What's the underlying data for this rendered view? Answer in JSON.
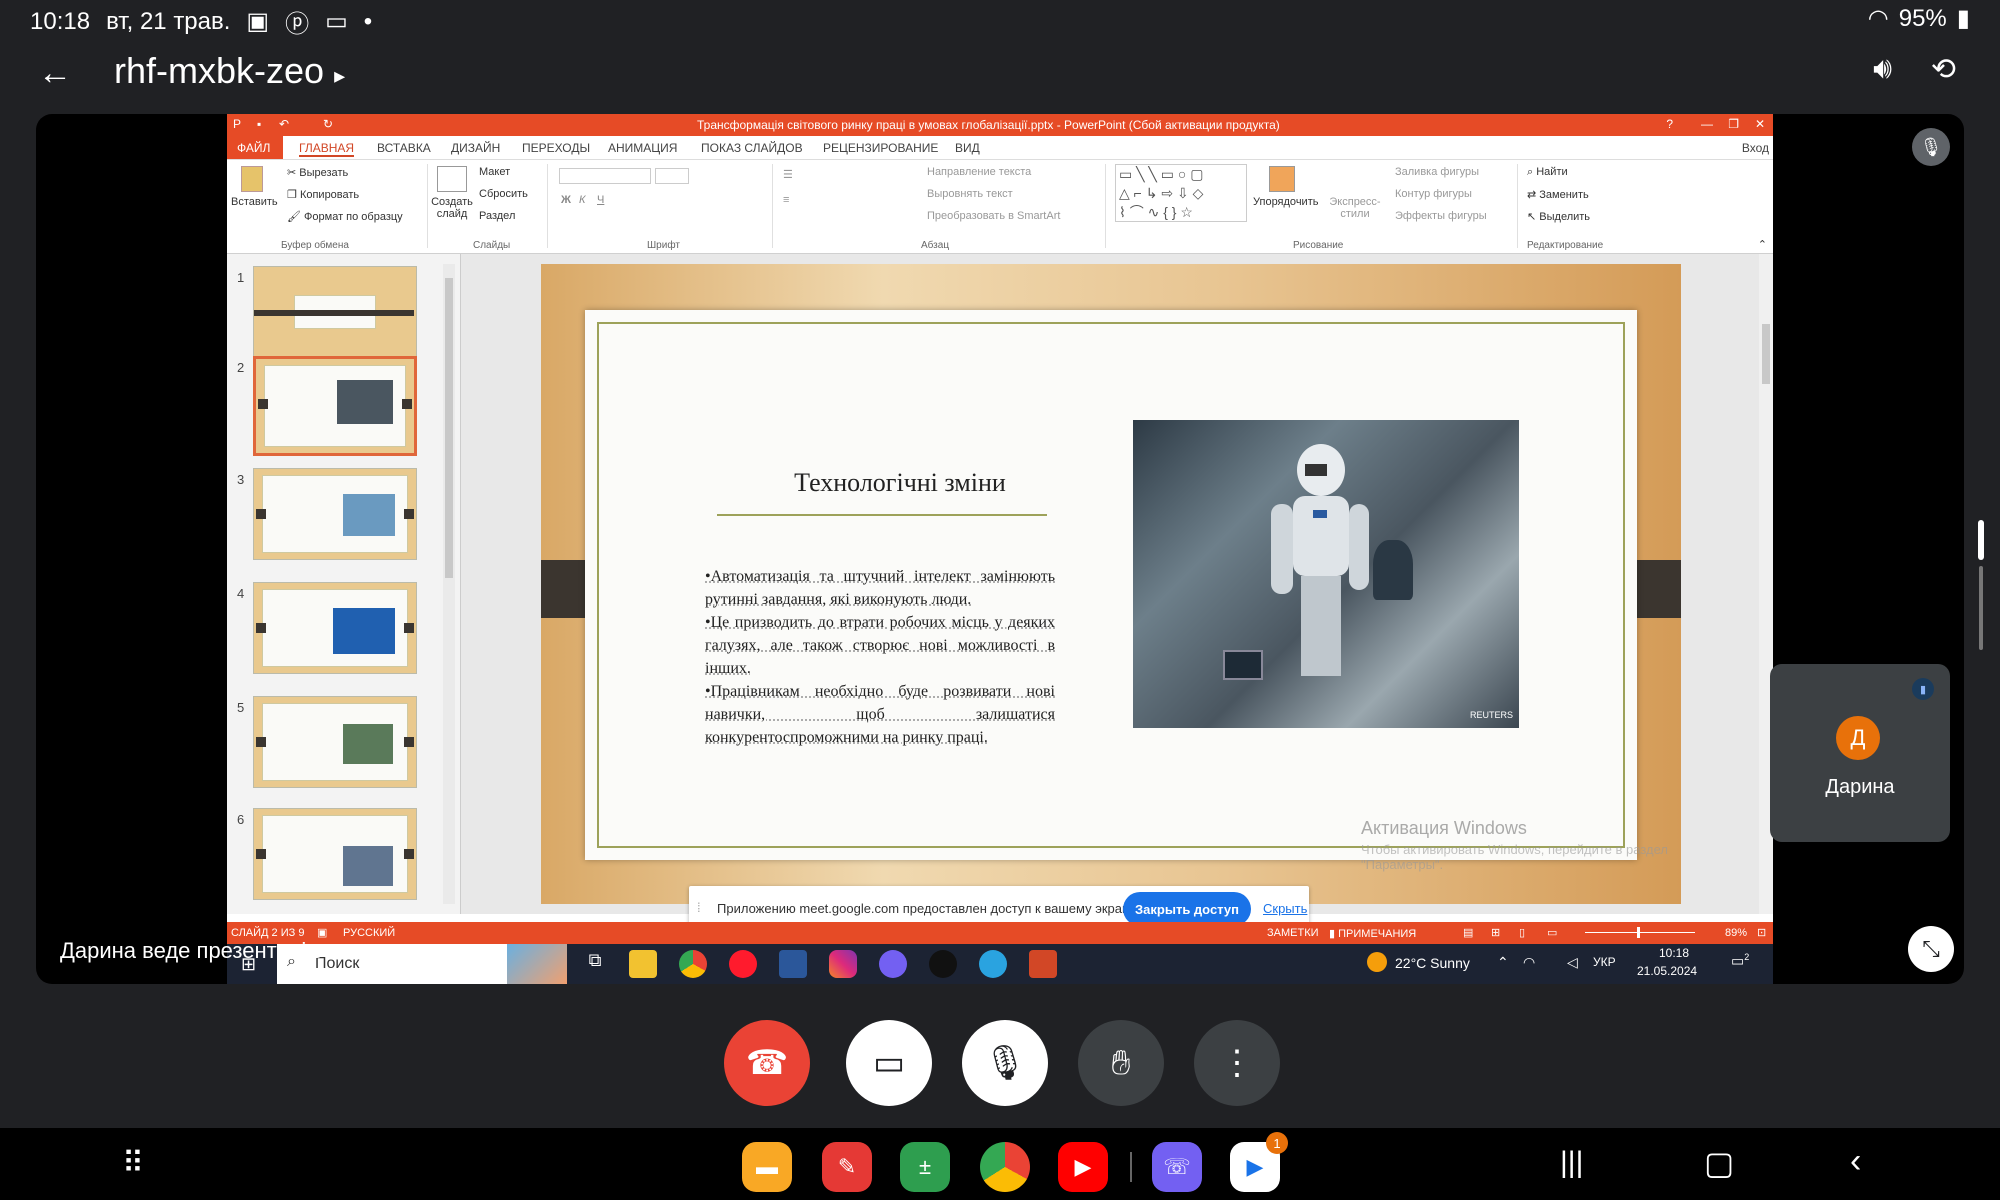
{
  "status_bar": {
    "time": "10:18",
    "date": "вт, 21 трав.",
    "battery": "95%"
  },
  "meet": {
    "meeting_code": "rhf-mxbk-zeo",
    "presenter_label": "Дарина веде презентацію",
    "participant": {
      "name": "Дарина",
      "initial": "Д"
    }
  },
  "powerpoint": {
    "window_title": "Трансформація світового ринку праці в умовах глобалізації.pptx - PowerPoint (Сбой активации продукта)",
    "tabs": [
      "ФАЙЛ",
      "ГЛАВНАЯ",
      "ВСТАВКА",
      "ДИЗАЙН",
      "ПЕРЕХОДЫ",
      "АНИМАЦИЯ",
      "ПОКАЗ СЛАЙДОВ",
      "РЕЦЕНЗИРОВАНИЕ",
      "ВИД"
    ],
    "signin": "Вход",
    "ribbon": {
      "paste": "Вставить",
      "cut": "Вырезать",
      "copy": "Копировать",
      "format_painter": "Формат по образцу",
      "clipboard_group": "Буфер обмена",
      "new_slide": "Создать слайд",
      "layout": "Макет",
      "reset": "Сбросить",
      "section": "Раздел",
      "slides_group": "Слайды",
      "font_group": "Шрифт",
      "text_direction": "Направление текста",
      "align_text": "Выровнять текст",
      "smartart": "Преобразовать в SmartArt",
      "paragraph_group": "Абзац",
      "arrange": "Упорядочить",
      "quick_styles": "Экспресс-стили",
      "shape_fill": "Заливка фигуры",
      "shape_outline": "Контур фигуры",
      "shape_effects": "Эффекты фигуры",
      "drawing_group": "Рисование",
      "find": "Найти",
      "replace": "Заменить",
      "select": "Выделить",
      "editing_group": "Редактирование"
    },
    "slide_numbers": [
      "1",
      "2",
      "3",
      "4",
      "5",
      "6"
    ],
    "slide": {
      "title": "Технологічні зміни",
      "bullets": [
        "•Автоматизація та штучний інтелект замінюють рутинні завдання, які виконують люди.",
        "•Це призводить до втрати робочих місць у деяких галузях, але також створює нові можливості в інших.",
        "•Працівникам необхідно буде розвивати нові навички, щоб залишатися конкурентоспроможними на ринку праці."
      ],
      "photo_credit": "REUTERS"
    },
    "activation_title": "Активация Windows",
    "activation_text": "Чтобы активировать Windows, перейдите в раздел \"Параметры\".",
    "share_message": "Приложению meet.google.com предоставлен доступ к вашему экрану.",
    "close_access": "Закрыть доступ",
    "hide": "Скрыть",
    "status_slide": "СЛАЙД 2 ИЗ 9",
    "status_lang": "РУССКИЙ",
    "status_notes": "ЗАМЕТКИ",
    "status_comments": "ПРИМЕЧАНИЯ",
    "zoom": "89%"
  },
  "windows_taskbar": {
    "search": "Поиск",
    "weather": "22°C Sunny",
    "lang": "УКР",
    "time": "10:18",
    "date": "21.05.2024",
    "notif_count": "2"
  },
  "dock": {
    "badge": "1"
  },
  "colors": {
    "ppt_accent": "#e64b26",
    "meet_end_call": "#ea4335",
    "meet_blue": "#1a73e8",
    "avatar": "#e8710a"
  }
}
